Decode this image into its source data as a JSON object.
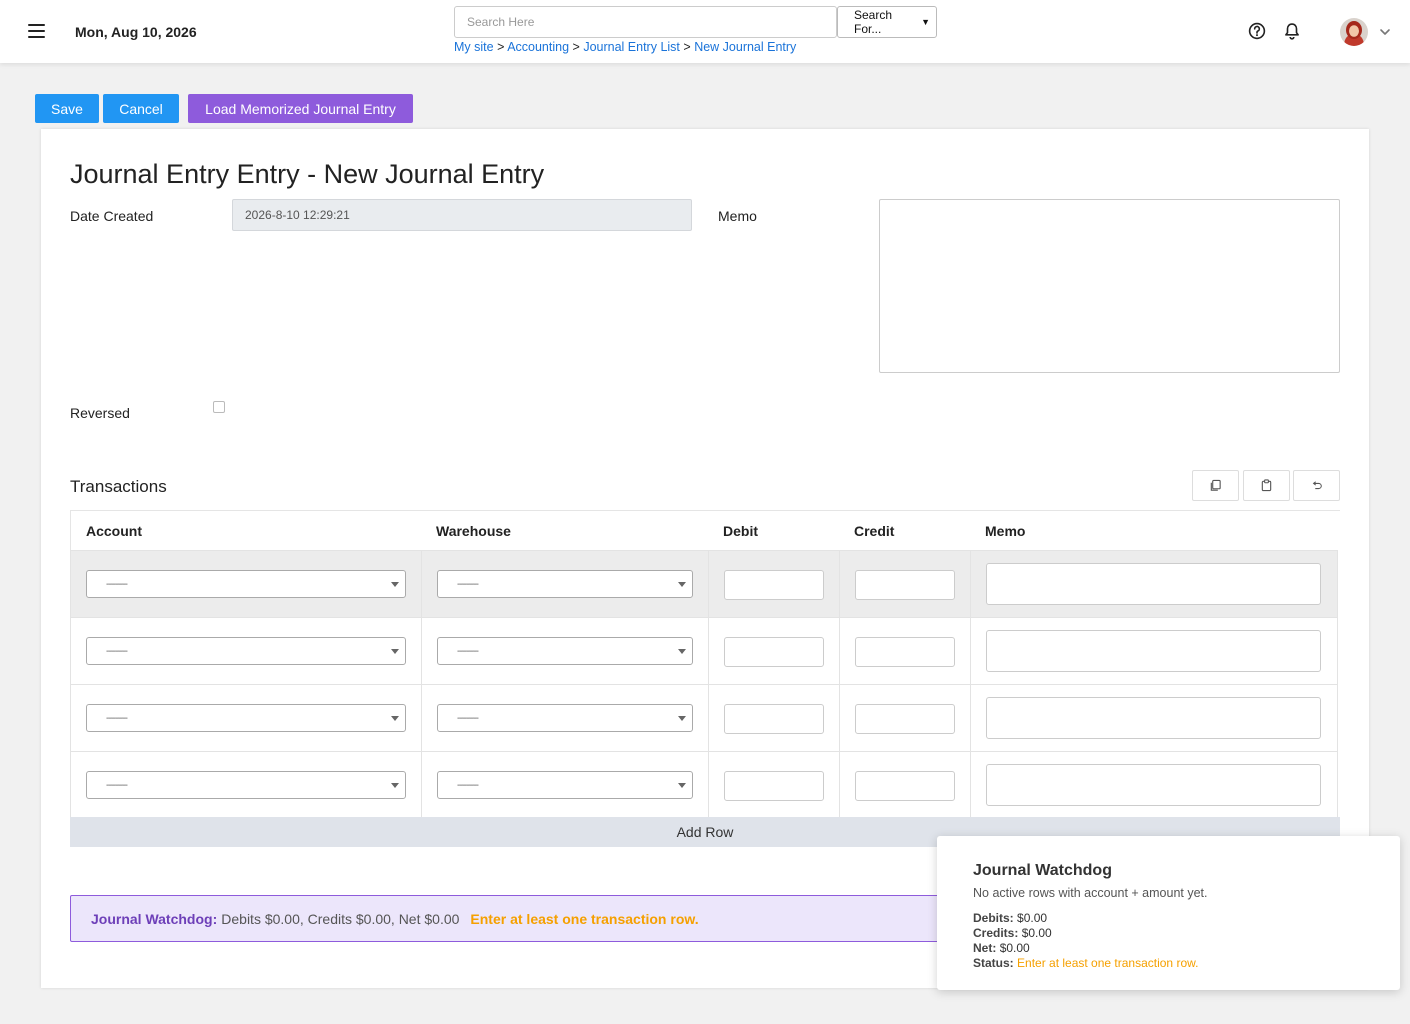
{
  "header": {
    "date": "Mon, Aug 10, 2026",
    "search_placeholder": "Search Here",
    "search_select_value": "Search For...",
    "breadcrumb": [
      {
        "label": "My site"
      },
      {
        "label": "Accounting"
      },
      {
        "label": "Journal Entry List"
      },
      {
        "label": "New Journal Entry"
      }
    ],
    "breadcrumb_separator": ">",
    "icons": [
      "menu-icon",
      "help-icon",
      "bell-icon",
      "avatar",
      "chevron-down-icon"
    ]
  },
  "toolbar": {
    "save_label": "Save",
    "cancel_label": "Cancel",
    "load_label": "Load Memorized Journal Entry",
    "colors": {
      "primary": "#2196f3",
      "purple": "#8e5bdc"
    }
  },
  "form": {
    "title": "Journal Entry Entry - New Journal Entry",
    "date_created_label": "Date Created",
    "date_created_value": "2026-8-10 12:29:21",
    "memo_label": "Memo",
    "memo_value": "",
    "reversed_label": "Reversed",
    "reversed_checked": false
  },
  "transactions": {
    "title": "Transactions",
    "tools": [
      "copy-icon",
      "paste-icon",
      "undo-icon"
    ],
    "columns": [
      "Account",
      "Warehouse",
      "Debit",
      "Credit",
      "Memo"
    ],
    "rows": [
      {
        "account": "---------",
        "warehouse": "---------",
        "debit": "",
        "credit": "",
        "memo": ""
      },
      {
        "account": "---------",
        "warehouse": "---------",
        "debit": "",
        "credit": "",
        "memo": ""
      },
      {
        "account": "---------",
        "warehouse": "---------",
        "debit": "",
        "credit": "",
        "memo": ""
      },
      {
        "account": "---------",
        "warehouse": "---------",
        "debit": "",
        "credit": "",
        "memo": ""
      }
    ],
    "add_row_label": "Add Row"
  },
  "watchdog_bar": {
    "title": "Journal Watchdog:",
    "summary": "Debits $0.00, Credits $0.00, Net $0.00",
    "warning": "Enter at least one transaction row."
  },
  "watchdog_popup": {
    "title": "Journal Watchdog",
    "subtitle": "No active rows with account + amount yet.",
    "debits_label": "Debits:",
    "debits_value": "$0.00",
    "credits_label": "Credits:",
    "credits_value": "$0.00",
    "net_label": "Net:",
    "net_value": "$0.00",
    "status_label": "Status:",
    "status_value": "Enter at least one transaction row.",
    "status_color": "#f5a000"
  }
}
